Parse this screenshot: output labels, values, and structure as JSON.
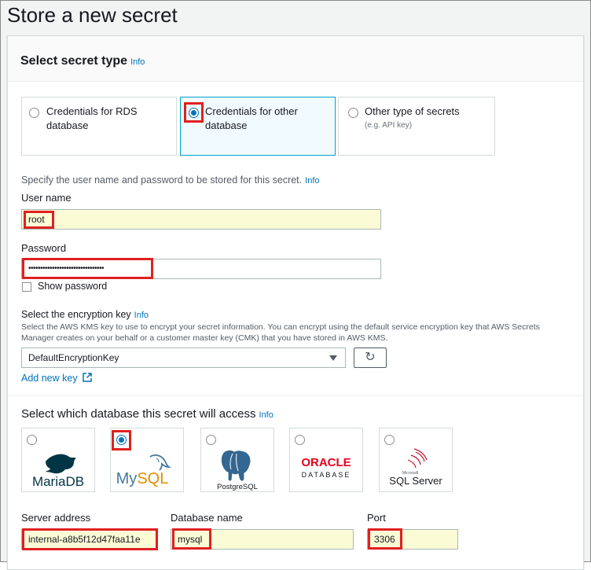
{
  "page": {
    "title": "Store a new secret"
  },
  "secret_type": {
    "title": "Select secret type",
    "info": "Info",
    "options": [
      {
        "label_line1": "Credentials for RDS",
        "label_line2": "database",
        "selected": false
      },
      {
        "label_line1": "Credentials for other",
        "label_line2": "database",
        "selected": true
      },
      {
        "label_line1": "Other type of secrets",
        "sub": "(e.g. API key)",
        "selected": false
      }
    ]
  },
  "credentials": {
    "specify_text": "Specify the user name and password to be stored for this secret.",
    "info": "Info",
    "username_label": "User name",
    "username_value": "root",
    "password_label": "Password",
    "password_value": "••••••••••••••••••••••••••••••••",
    "show_password": "Show password"
  },
  "encryption": {
    "label": "Select the encryption key",
    "info": "Info",
    "desc_line1": "Select the AWS KMS key to use to encrypt your secret information. You can encrypt using the default service encryption key that AWS Secrets",
    "desc_line2": "Manager creates on your behalf or a customer master key (CMK) that you have stored in AWS KMS.",
    "selected_key": "DefaultEncryptionKey",
    "add_new_key": "Add new key"
  },
  "database": {
    "title": "Select which database this secret will access",
    "info": "Info",
    "engines": [
      {
        "name": "MariaDB",
        "selected": false
      },
      {
        "name": "MySQL",
        "selected": true
      },
      {
        "name": "PostgreSQL",
        "selected": false
      },
      {
        "name_line1": "ORACLE",
        "name_line2": "DATABASE",
        "selected": false
      },
      {
        "name_small": "Microsoft",
        "name": "SQL Server",
        "selected": false
      }
    ],
    "server_address_label": "Server address",
    "server_address_value": "internal-a8b5f12d47faa11e",
    "database_name_label": "Database name",
    "database_name_value": "mysql",
    "port_label": "Port",
    "port_value": "3306"
  },
  "colors": {
    "accent": "#0073bb",
    "highlight": "#e02020",
    "filled_input": "#fbfbd6"
  }
}
